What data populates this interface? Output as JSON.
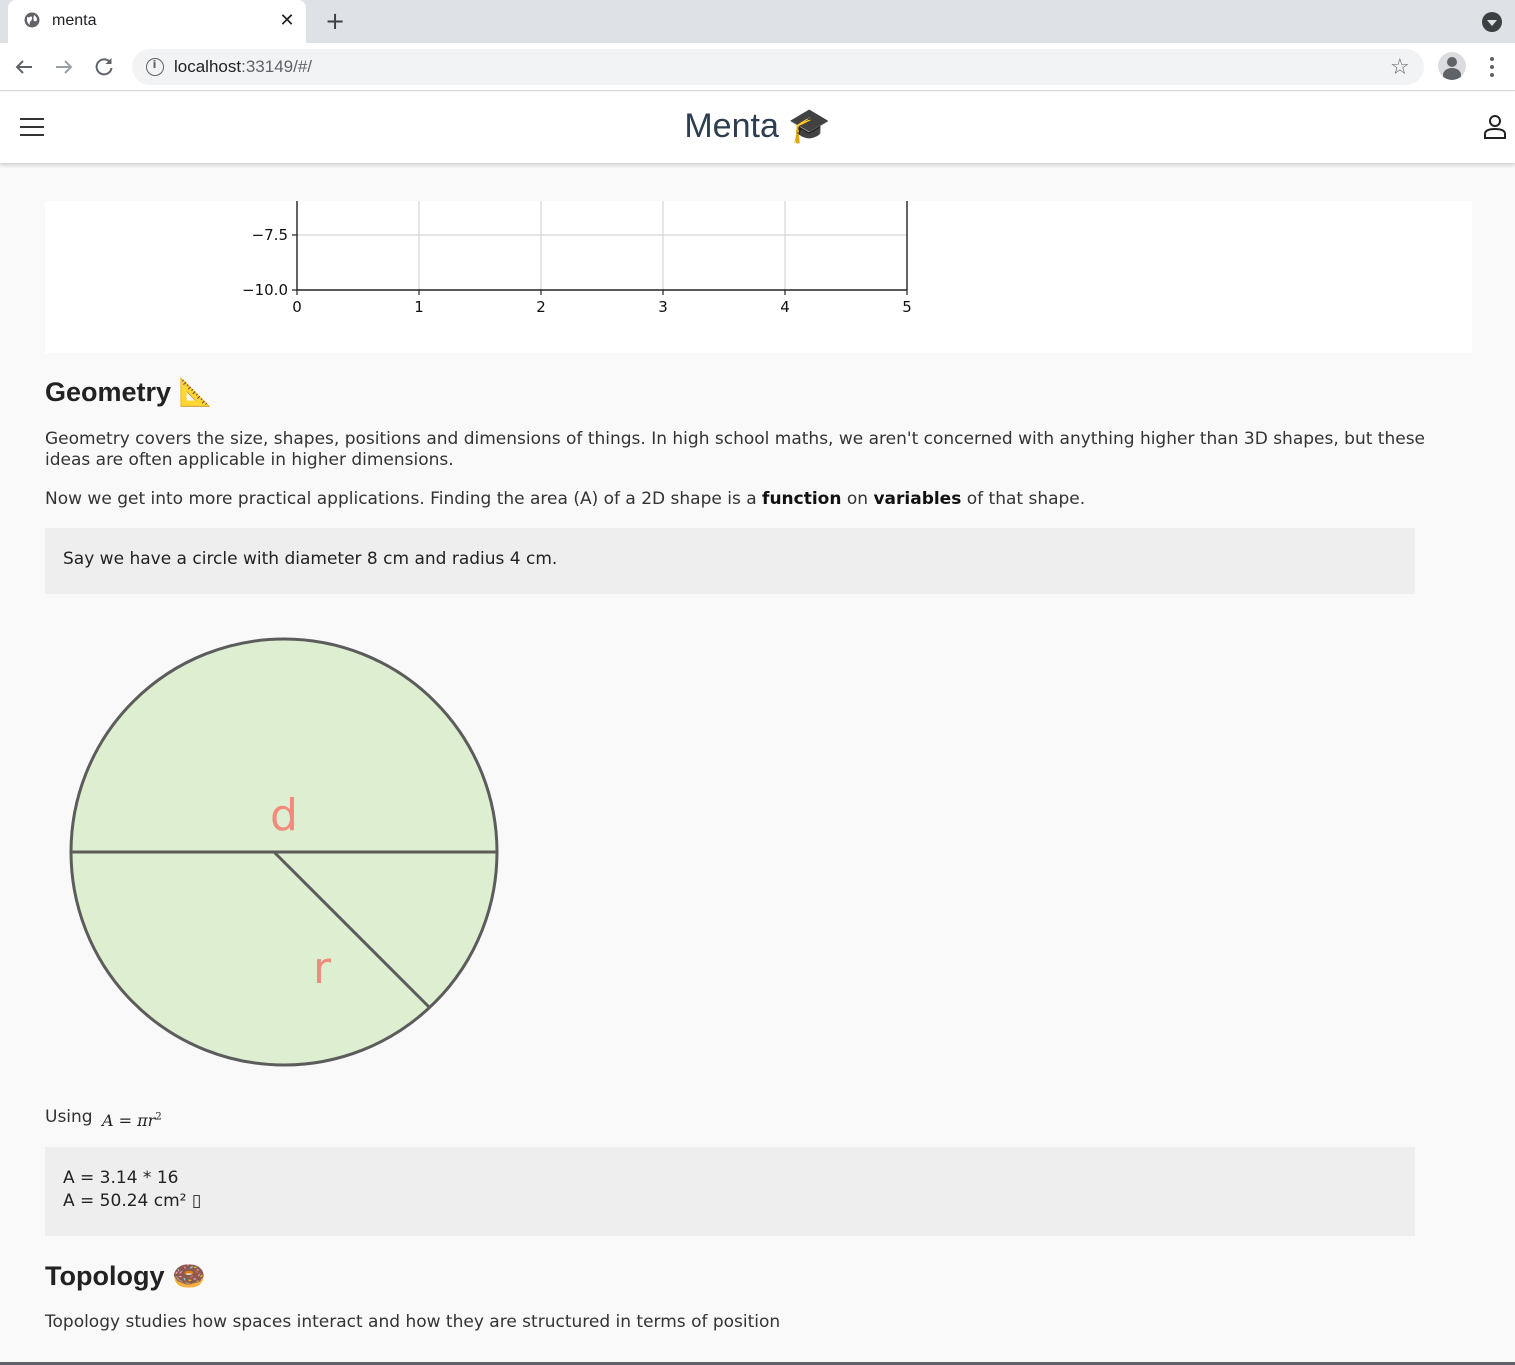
{
  "browser": {
    "tab_title": "menta",
    "tab_close": "✕",
    "new_tab": "+",
    "url_host": "localhost",
    "url_rest": ":33149/#/"
  },
  "header": {
    "title": "Menta 🎓"
  },
  "chart_data": {
    "type": "line",
    "partial": true,
    "xlim": [
      0,
      5
    ],
    "x_ticks": [
      "0",
      "1",
      "2",
      "3",
      "4",
      "5"
    ],
    "y_ticks": [
      "−7.5",
      "−10.0"
    ],
    "grid": true
  },
  "geometry": {
    "heading": "Geometry 📐",
    "para1": "Geometry covers the size, shapes, positions and dimensions of things. In high school maths, we aren't concerned with anything higher than 3D shapes, but these ideas are often applicable in higher dimensions.",
    "para2_a": "Now we get into more practical applications. Finding the area (A) of a 2D shape is a ",
    "para2_function": "function",
    "para2_b": " on ",
    "para2_variables": "variables",
    "para2_c": " of that shape.",
    "note": "Say we have a circle with diameter 8 cm and radius 4 cm.",
    "circle_label_d": "d",
    "circle_label_r": "r",
    "circle_fill": "#ddefd0",
    "label_color": "#f28b7d",
    "using": "Using",
    "formula_lhs": "A",
    "formula_eq": " = ",
    "formula_rhs": "πr",
    "formula_exp": "2",
    "calc_line1": "A = 3.14 * 16",
    "calc_line2": "A = 50.24 cm² ▯"
  },
  "topology": {
    "heading": "Topology 🍩",
    "para1": "Topology studies how spaces interact and how they are structured in terms of position"
  }
}
